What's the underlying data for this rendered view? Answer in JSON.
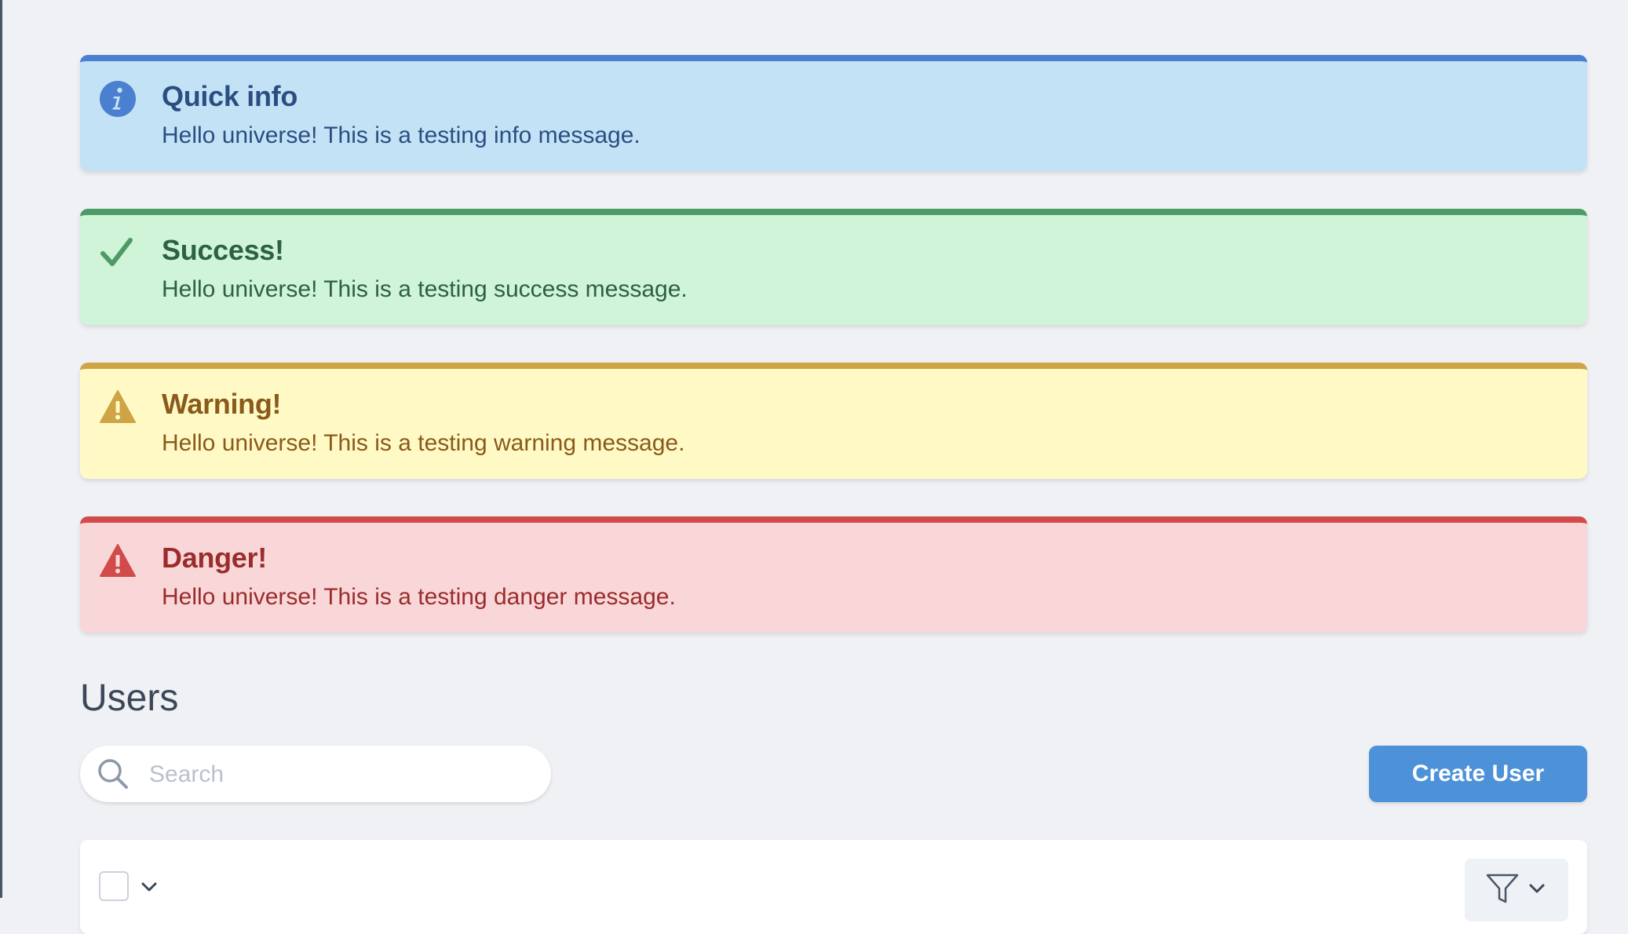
{
  "alerts": [
    {
      "type": "info",
      "icon": "info-icon",
      "title": "Quick info",
      "message": "Hello universe! This is a testing info message."
    },
    {
      "type": "success",
      "icon": "check-icon",
      "title": "Success!",
      "message": "Hello universe! This is a testing success message."
    },
    {
      "type": "warning",
      "icon": "warning-icon",
      "title": "Warning!",
      "message": "Hello universe! This is a testing warning message."
    },
    {
      "type": "danger",
      "icon": "danger-icon",
      "title": "Danger!",
      "message": "Hello universe! This is a testing danger message."
    }
  ],
  "users": {
    "heading": "Users",
    "search": {
      "placeholder": "Search",
      "value": "",
      "icon": "search-icon"
    },
    "create_button_label": "Create User",
    "toolbar": {
      "select_all_icon": "checkbox",
      "select_menu_icon": "chevron-down-icon",
      "filter_icon": "funnel-icon",
      "filter_menu_icon": "chevron-down-icon"
    }
  },
  "colors": {
    "info": "#4a80cf",
    "success": "#4e9a66",
    "warning": "#cfa445",
    "danger": "#d04b49",
    "primary_button": "#4d92d8",
    "page_background": "#eff1f5"
  }
}
